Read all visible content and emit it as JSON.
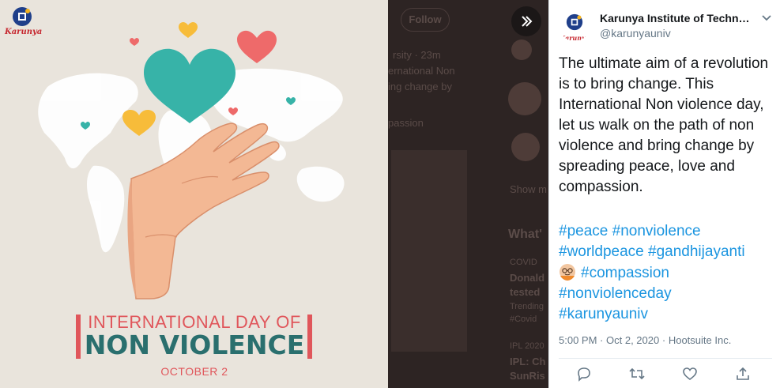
{
  "image": {
    "logo_text": "Karunya",
    "poster": {
      "line1": "INTERNATIONAL DAY OF",
      "line2": "NON VIOLENCE",
      "date": "OCTOBER 2"
    }
  },
  "background_page": {
    "follow_label": "Follow",
    "fragments": [
      "rsity · 23m",
      "ernational Non",
      "ing change by",
      "passion",
      "Show m",
      "What'",
      "COVID",
      "Donald",
      "tested",
      "Trending",
      "#Covid",
      "IPL 2020",
      "IPL: Ch",
      "SunRis"
    ]
  },
  "tweet": {
    "author_name": "Karunya Institute of Technology and Sciences",
    "author_handle": "@karunyauniv",
    "avatar_logo_text": "Karunya",
    "text": "The ultimate aim of a revolution is to bring change. This International Non violence day, let us walk on the path of non violence and bring change by spreading peace, love and compassion.",
    "hashtags": [
      "#peace",
      "#nonviolence",
      "#worldpeace",
      "#gandhijayanti",
      "#compassion",
      "#nonviolenceday",
      "#karunyauniv"
    ],
    "time": "5:00 PM",
    "date": "Oct 2, 2020",
    "source": "Hootsuite Inc.",
    "meta_separator": "·",
    "emoji": "gandhi-emoji"
  },
  "icons": {
    "collapse": "double-chevron-right-icon",
    "caret": "chevron-down-icon",
    "reply": "reply-icon",
    "retweet": "retweet-icon",
    "like": "heart-icon",
    "share": "share-icon"
  },
  "colors": {
    "hashtag": "#1b95e0",
    "poster_red": "#e0565b",
    "poster_teal": "#2a6f6e",
    "heart_teal": "#37b3a8",
    "heart_coral": "#ee6a6a",
    "heart_yellow": "#f7bc3a",
    "overlay": "#2d2423"
  }
}
